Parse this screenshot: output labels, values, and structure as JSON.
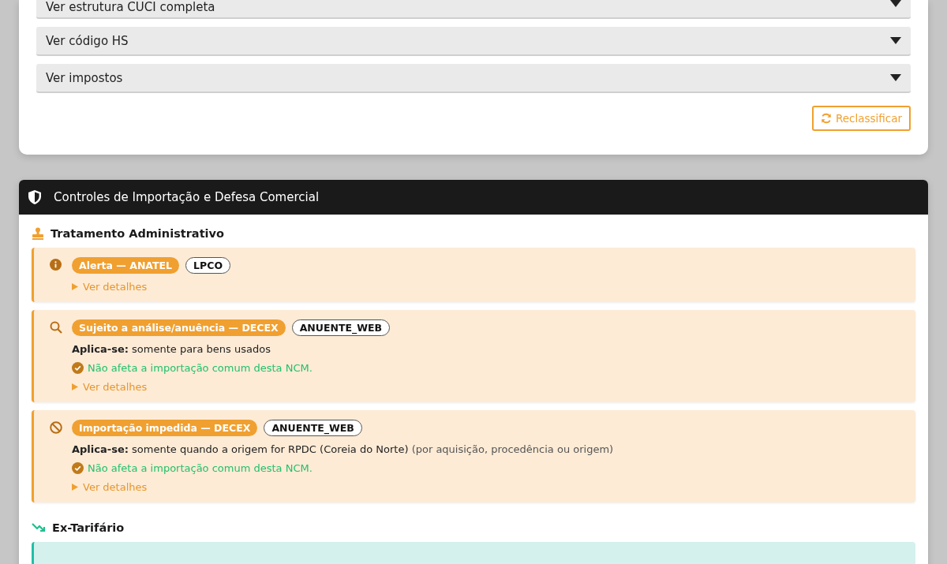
{
  "classification_card": {
    "accordions": [
      {
        "label": "Ver estrutura CUCI completa",
        "expanded": false
      },
      {
        "label": "Ver código HS",
        "expanded": false
      },
      {
        "label": "Ver impostos",
        "expanded": false
      }
    ],
    "reclassify_button": "Reclassificar"
  },
  "controls_panel": {
    "title": "Controles de Importação e Defesa Comercial",
    "sections": [
      {
        "kind": "admin",
        "title": "Tratamento Administrativo",
        "alerts": [
          {
            "kind": "info",
            "badge": "Alerta — ANATEL",
            "tag": "LPCO",
            "details": {
              "label": "Ver detalhes",
              "expanded": false
            }
          },
          {
            "kind": "search",
            "badge": "Sujeito a análise/anuência — DECEX",
            "tag": "ANUENTE_WEB",
            "applies": {
              "label": "Aplica-se:",
              "text": "somente para bens usados"
            },
            "ok_message": "Não afeta a importação comum desta NCM.",
            "details": {
              "label": "Ver detalhes",
              "expanded": false
            }
          },
          {
            "kind": "blocked",
            "badge": "Importação impedida — DECEX",
            "tag": "ANUENTE_WEB",
            "applies": {
              "label": "Aplica-se:",
              "text": "somente quando a origem for RPDC (Coreia do Norte)",
              "note": "(por aquisição, procedência ou origem)"
            },
            "ok_message": "Não afeta a importação comum desta NCM.",
            "details": {
              "label": "Ver detalhes",
              "expanded": false
            }
          }
        ]
      },
      {
        "kind": "ex_tariff",
        "title": "Ex-Tarifário"
      }
    ]
  }
}
